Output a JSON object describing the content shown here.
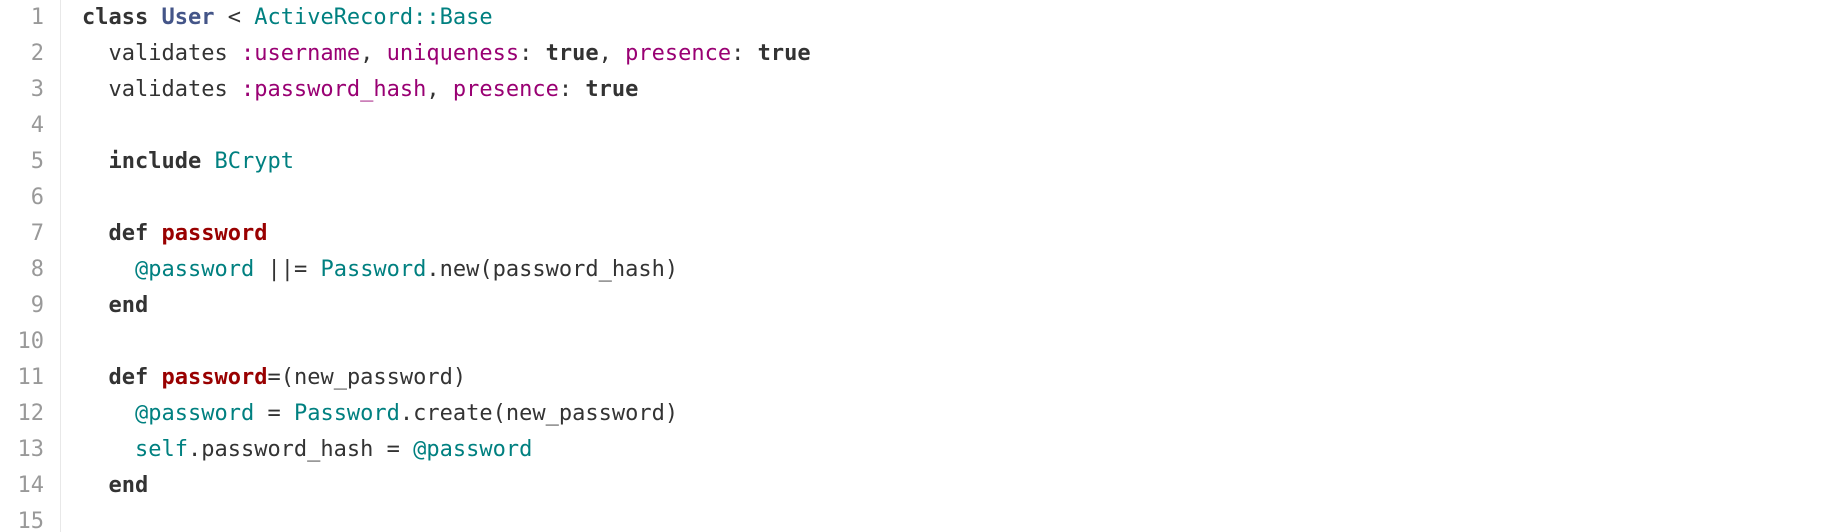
{
  "editor": {
    "colors": {
      "keyword": "#333333",
      "class_name": "#445588",
      "constant": "#008080",
      "symbol": "#990073",
      "function": "#990000",
      "instance_var": "#008080",
      "line_number": "#999999"
    },
    "lines": [
      {
        "number": "1",
        "tokens": [
          {
            "t": "kw",
            "v": "class"
          },
          {
            "t": "plain",
            "v": " "
          },
          {
            "t": "class",
            "v": "User"
          },
          {
            "t": "plain",
            "v": " "
          },
          {
            "t": "op",
            "v": "<"
          },
          {
            "t": "plain",
            "v": " "
          },
          {
            "t": "const",
            "v": "ActiveRecord::Base"
          }
        ]
      },
      {
        "number": "2",
        "tokens": [
          {
            "t": "plain",
            "v": "  validates "
          },
          {
            "t": "sym",
            "v": ":username"
          },
          {
            "t": "plain",
            "v": ", "
          },
          {
            "t": "sym",
            "v": "uniqueness"
          },
          {
            "t": "plain",
            "v": ": "
          },
          {
            "t": "bool",
            "v": "true"
          },
          {
            "t": "plain",
            "v": ", "
          },
          {
            "t": "sym",
            "v": "presence"
          },
          {
            "t": "plain",
            "v": ": "
          },
          {
            "t": "bool",
            "v": "true"
          }
        ]
      },
      {
        "number": "3",
        "tokens": [
          {
            "t": "plain",
            "v": "  validates "
          },
          {
            "t": "sym",
            "v": ":password_hash"
          },
          {
            "t": "plain",
            "v": ", "
          },
          {
            "t": "sym",
            "v": "presence"
          },
          {
            "t": "plain",
            "v": ": "
          },
          {
            "t": "bool",
            "v": "true"
          }
        ]
      },
      {
        "number": "4",
        "tokens": []
      },
      {
        "number": "5",
        "tokens": [
          {
            "t": "plain",
            "v": "  "
          },
          {
            "t": "kw",
            "v": "include"
          },
          {
            "t": "plain",
            "v": " "
          },
          {
            "t": "const",
            "v": "BCrypt"
          }
        ]
      },
      {
        "number": "6",
        "tokens": []
      },
      {
        "number": "7",
        "tokens": [
          {
            "t": "plain",
            "v": "  "
          },
          {
            "t": "kw",
            "v": "def"
          },
          {
            "t": "plain",
            "v": " "
          },
          {
            "t": "func",
            "v": "password"
          }
        ]
      },
      {
        "number": "8",
        "tokens": [
          {
            "t": "plain",
            "v": "    "
          },
          {
            "t": "ivar",
            "v": "@password"
          },
          {
            "t": "plain",
            "v": " "
          },
          {
            "t": "op",
            "v": "||="
          },
          {
            "t": "plain",
            "v": " "
          },
          {
            "t": "const",
            "v": "Password"
          },
          {
            "t": "plain",
            "v": ".new(password_hash)"
          }
        ]
      },
      {
        "number": "9",
        "tokens": [
          {
            "t": "plain",
            "v": "  "
          },
          {
            "t": "kw",
            "v": "end"
          }
        ]
      },
      {
        "number": "10",
        "tokens": []
      },
      {
        "number": "11",
        "tokens": [
          {
            "t": "plain",
            "v": "  "
          },
          {
            "t": "kw",
            "v": "def"
          },
          {
            "t": "plain",
            "v": " "
          },
          {
            "t": "func",
            "v": "password"
          },
          {
            "t": "plain",
            "v": "=(new_password)"
          }
        ]
      },
      {
        "number": "12",
        "tokens": [
          {
            "t": "plain",
            "v": "    "
          },
          {
            "t": "ivar",
            "v": "@password"
          },
          {
            "t": "plain",
            "v": " = "
          },
          {
            "t": "const",
            "v": "Password"
          },
          {
            "t": "plain",
            "v": ".create(new_password)"
          }
        ]
      },
      {
        "number": "13",
        "tokens": [
          {
            "t": "plain",
            "v": "    "
          },
          {
            "t": "const",
            "v": "self"
          },
          {
            "t": "plain",
            "v": ".password_hash = "
          },
          {
            "t": "ivar",
            "v": "@password"
          }
        ]
      },
      {
        "number": "14",
        "tokens": [
          {
            "t": "plain",
            "v": "  "
          },
          {
            "t": "kw",
            "v": "end"
          }
        ]
      },
      {
        "number": "15",
        "tokens": []
      }
    ]
  }
}
